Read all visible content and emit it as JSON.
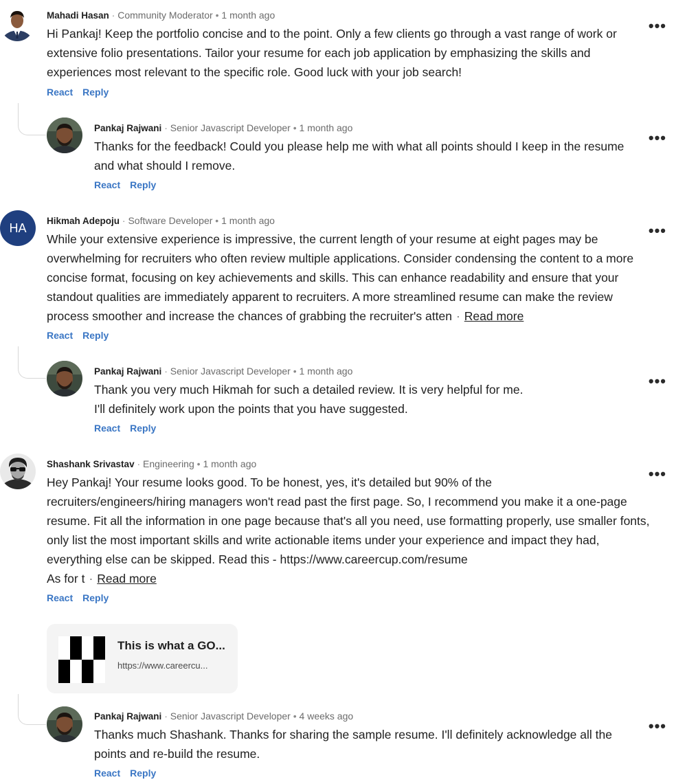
{
  "actions": {
    "react_label": "React",
    "reply_label": "Reply",
    "read_more_label": "Read more",
    "more_label": "•••"
  },
  "comments": [
    {
      "author": "Mahadi Hasan",
      "headline": "Community Moderator",
      "time": "1 month ago",
      "avatar": "photo",
      "text": "Hi Pankaj! Keep the portfolio concise and to the point. Only a few clients go through a vast range of work or extensive folio presentations. Tailor your resume for each job application by emphasizing the skills and experiences most relevant to the specific role. Good luck with your job search!",
      "reply": {
        "author": "Pankaj Rajwani",
        "headline": "Senior Javascript Developer",
        "time": "1 month ago",
        "text": "Thanks for the feedback! Could you please help me with what all points should I keep in the resume and what should I remove."
      }
    },
    {
      "author": "Hikmah Adepoju",
      "headline": "Software Developer",
      "time": "1 month ago",
      "avatar": "initials",
      "initials": "HA",
      "text": "While your extensive experience is impressive, the current length of your resume at eight pages may be overwhelming for recruiters who often review multiple applications. Consider condensing the content to a more concise format, focusing on key achievements and skills. This can enhance readability and ensure that your standout qualities are immediately apparent to recruiters. A more streamlined resume can make the review process smoother and increase the chances of grabbing the recruiter's atten",
      "reply": {
        "author": "Pankaj Rajwani",
        "headline": "Senior Javascript Developer",
        "time": "1 month ago",
        "text_line1": "Thank you very much Hikmah for such a detailed review. It is very helpful for me.",
        "text_line2": "I'll definitely work upon the points that you have suggested."
      }
    },
    {
      "author": "Shashank Srivastav",
      "headline": "Engineering",
      "time": "1 month ago",
      "avatar": "photo",
      "text_line1": "Hey Pankaj! Your resume looks good. To be honest, yes, it's detailed but 90% of the",
      "text_rest": "recruiters/engineers/hiring managers won't read past the first page. So, I recommend you make it a one-page resume. Fit all the information in one page because that's all you need, use formatting properly, use smaller fonts, only list the most important skills and write actionable items under your experience and impact they had, everything else can be skipped. Read this - https://www.careercup.com/resume",
      "text_tail": "As for t",
      "link_preview": {
        "title": "This is what a GO...",
        "url": "https://www.careercu..."
      },
      "reply": {
        "author": "Pankaj Rajwani",
        "headline": "Senior Javascript Developer",
        "time": "4 weeks ago",
        "text": "Thanks much Shashank. Thanks for sharing the sample resume. I'll definitely acknowledge all the points and re-build the resume."
      }
    }
  ],
  "colors": {
    "action_blue": "#3a76c4",
    "initials_avatar_bg": "#1f3f7f",
    "muted_text": "#6b6b6b"
  }
}
